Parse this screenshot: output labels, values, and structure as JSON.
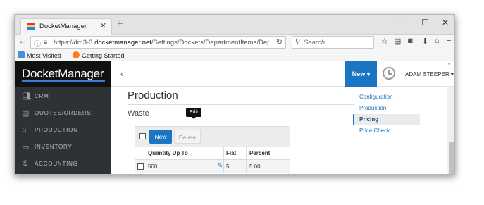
{
  "browser": {
    "tab_title": "DocketManager",
    "tab_close": "✕",
    "new_tab": "+",
    "url_prefix": "https://dm3-3.",
    "url_domain": "docketmanager.net",
    "url_path": "/Settings/Dockets/DepartmentItems/Depa",
    "search_placeholder": "Search",
    "bookmarks": [
      "Most Visited",
      "Getting Started"
    ]
  },
  "app": {
    "logo": "DocketManager",
    "sidebar": [
      {
        "label": "CRM",
        "icon": "users-icon"
      },
      {
        "label": "QUOTES/ORDERS",
        "icon": "document-icon"
      },
      {
        "label": "PRODUCTION",
        "icon": "factory-icon"
      },
      {
        "label": "INVENTORY",
        "icon": "inbox-icon"
      },
      {
        "label": "ACCOUNTING",
        "icon": "dollar-icon"
      }
    ],
    "topbar": {
      "new_button": "New ▾",
      "user": "ADAM STEEPER ▾"
    },
    "page_title": "Production",
    "section_title": "Waste",
    "table": {
      "new_button": "New",
      "delete_button": "Delete",
      "columns": [
        "Quantity Up To",
        "Flat",
        "Percent"
      ],
      "rows": [
        {
          "quantity": "500",
          "flat": "5",
          "percent": "5.00"
        }
      ],
      "tooltip": "Edit"
    },
    "right_nav": [
      {
        "label": "Configuration",
        "active": false
      },
      {
        "label": "Production",
        "active": false
      },
      {
        "label": "Pricing",
        "active": true
      },
      {
        "label": "Price Check",
        "active": false
      }
    ]
  },
  "colors": {
    "accent": "#1a75c2",
    "sidebar_bg": "#2f3234",
    "logo_bg": "#111111"
  }
}
